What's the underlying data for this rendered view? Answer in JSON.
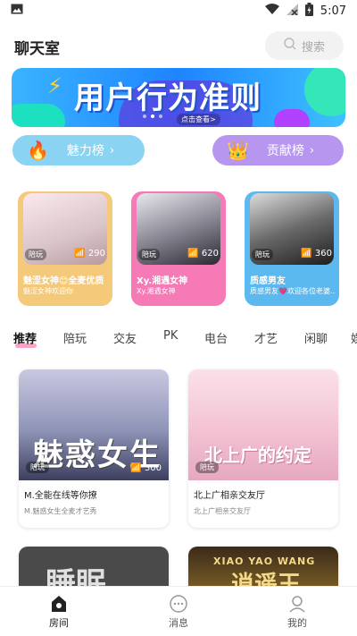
{
  "status": {
    "time": "5:07"
  },
  "header": {
    "title": "聊天室",
    "search_placeholder": "搜索"
  },
  "banner": {
    "title": "用户行为准则",
    "subtitle": "点击查看>"
  },
  "rankings": {
    "charm": "魅力榜",
    "contribution": "贡献榜"
  },
  "hot_rooms": [
    {
      "tag": "陪玩",
      "count": "290",
      "name": "魅涩女神😊全麦优质",
      "desc": "魅涩女神欢迎你",
      "color": "#f5c97a"
    },
    {
      "tag": "陪玩",
      "count": "620",
      "name": "Xy.湘遇女神",
      "desc": "Xy.湘遇女神",
      "color": "#f57ab6"
    },
    {
      "tag": "陪玩",
      "count": "360",
      "name": "质感男友",
      "desc": "质感男友💗欢迎各位老婆...",
      "color": "#5bb9f0"
    }
  ],
  "tabs": [
    "推荐",
    "陪玩",
    "交友",
    "PK",
    "电台",
    "才艺",
    "闲聊",
    "娱"
  ],
  "rooms": [
    {
      "title": "M.全能在线等你撩",
      "subtitle": "M.魅惑女生全麦才艺秀",
      "tag": "陪玩",
      "count": "300",
      "img_text": "魅惑女生"
    },
    {
      "title": "北上广相亲交友厅",
      "subtitle": "北上广相亲交友厅",
      "tag": "陪玩",
      "count": "",
      "img_text": "北上广的约定"
    }
  ],
  "rooms_row2": [
    {
      "img_text": "睡眠"
    },
    {
      "img_text": "XIAO YAO WANG",
      "img_text2": "逍遥王"
    }
  ],
  "nav": [
    {
      "label": "房间",
      "icon": "home-icon"
    },
    {
      "label": "消息",
      "icon": "message-icon"
    },
    {
      "label": "我的",
      "icon": "profile-icon"
    }
  ],
  "colors": {
    "accent_pink": "#f7a4c5",
    "charm_blue": "#8bd3f3",
    "contrib_purple": "#b796f0"
  }
}
